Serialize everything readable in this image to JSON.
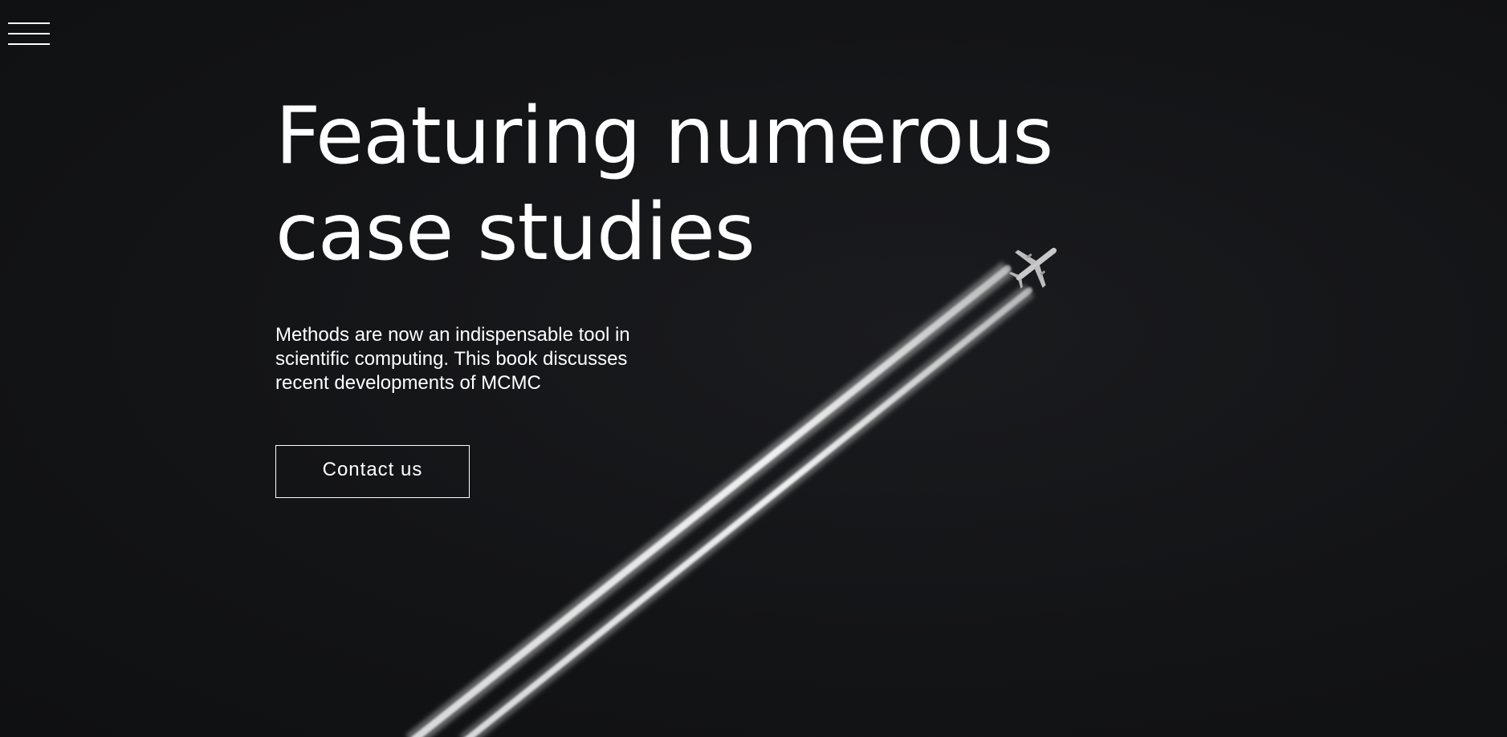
{
  "nav": {
    "menu_icon": "hamburger-menu-icon"
  },
  "hero": {
    "headline": "Featuring numerous case studies",
    "description": "Methods are now an indispensable tool in scientific computing. This book discusses recent developments of MCMC",
    "cta_label": "Contact us",
    "background": "airplane-contrails-image"
  },
  "colors": {
    "background": "#111214",
    "text": "#ffffff"
  }
}
